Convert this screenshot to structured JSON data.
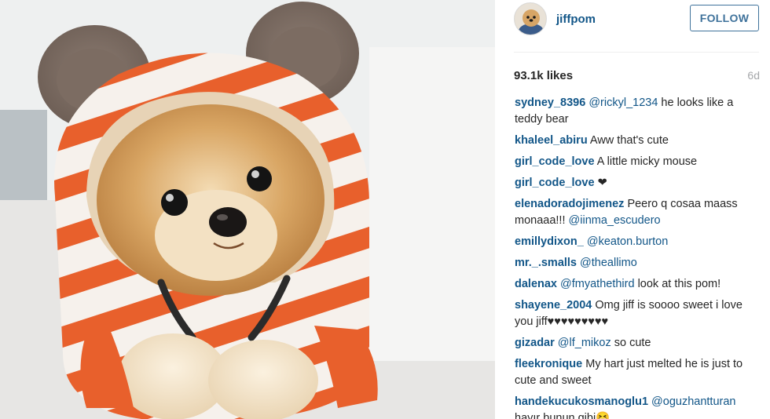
{
  "post": {
    "photo_alt": "Pomeranian dog wearing an orange and white striped hoodie with mouse ears",
    "colors": {
      "link": "#125688",
      "follow_border": "#3f729b",
      "muted": "#a5a7aa",
      "hoodie_orange": "#e8602c"
    }
  },
  "header": {
    "username": "jiffpom",
    "follow_label": "FOLLOW",
    "avatar_icon": "profile-avatar"
  },
  "stats": {
    "likes": "93.1k likes",
    "age": "6d"
  },
  "comments": [
    {
      "user": "sydney_8396",
      "mention": "@rickyl_1234",
      "text": "he looks like a teddy bear"
    },
    {
      "user": "khaleel_abiru",
      "mention": "",
      "text": "Aww that's cute"
    },
    {
      "user": "girl_code_love",
      "mention": "",
      "text": "A little micky mouse"
    },
    {
      "user": "girl_code_love",
      "mention": "",
      "text": "❤"
    },
    {
      "user": "elenadoradojimenez",
      "mention": "",
      "text": "Peero q cosaa maass monaaa!!!",
      "mention_after": "@iinma_escudero"
    },
    {
      "user": "emillydixon_",
      "mention": "@keaton.burton",
      "text": ""
    },
    {
      "user": "mr._.smalls",
      "mention": "@theallimo",
      "text": ""
    },
    {
      "user": "dalenax",
      "mention": "@fmyathethird",
      "text": "look at this pom!"
    },
    {
      "user": "shayene_2004",
      "mention": "",
      "text": "Omg jiff is soooo sweet i love you jiff♥♥♥♥♥♥♥♥♥"
    },
    {
      "user": "gizadar",
      "mention": "@lf_mikoz",
      "text": "so cute"
    },
    {
      "user": "fleekronique",
      "mention": "",
      "text": "My hart just melted he is just to cute and sweet"
    },
    {
      "user": "handekucukosmanoglu1",
      "mention": "@oguzhantturan",
      "text": "hayır bunun gibi😆"
    }
  ]
}
